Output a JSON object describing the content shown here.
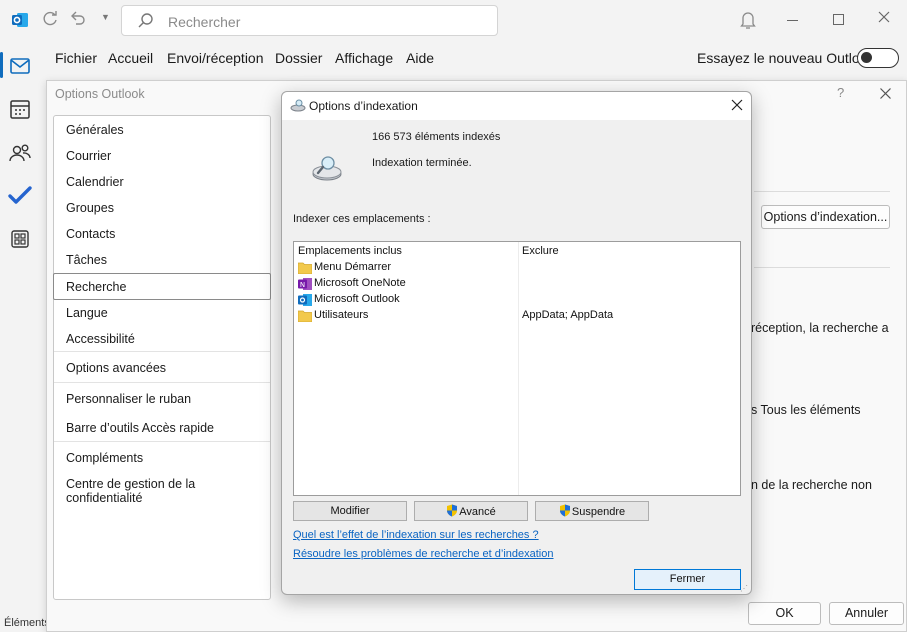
{
  "titlebar": {
    "search_placeholder": "Rechercher"
  },
  "menu": {
    "items": [
      "Fichier",
      "Accueil",
      "Envoi/réception",
      "Dossier",
      "Affichage",
      "Aide"
    ],
    "try_new": "Essayez le nouveau Outlook"
  },
  "options_dialog": {
    "title": "Options Outlook",
    "categories": [
      "Générales",
      "Courrier",
      "Calendrier",
      "Groupes",
      "Contacts",
      "Tâches",
      "Recherche",
      "Langue",
      "Accessibilité",
      "Options avancées",
      "Personnaliser le ruban",
      "Barre d’outils Accès rapide",
      "Compléments",
      "Centre de gestion de la confidentialité"
    ],
    "selected": "Recherche",
    "indexing_button": "Options d’indexation...",
    "partial_texts": [
      "réception, la recherche a",
      "s Tous les éléments",
      "n de la recherche non"
    ],
    "ok": "OK",
    "cancel": "Annuler"
  },
  "indexing_dialog": {
    "title": "Options d’indexation",
    "count": "166 573 éléments indexés",
    "status": "Indexation terminée.",
    "locations_label": "Indexer ces emplacements :",
    "col_included": "Emplacements inclus",
    "col_exclude": "Exclure",
    "rows": [
      {
        "name": "Menu Démarrer",
        "icon": "folder-icon",
        "exclude": ""
      },
      {
        "name": "Microsoft OneNote",
        "icon": "onenote-icon",
        "exclude": ""
      },
      {
        "name": "Microsoft Outlook",
        "icon": "outlook-icon",
        "exclude": ""
      },
      {
        "name": "Utilisateurs",
        "icon": "folder-icon",
        "exclude": "AppData; AppData"
      }
    ],
    "btn_modify": "Modifier",
    "btn_advanced": "Avancé",
    "btn_pause": "Suspendre",
    "link_effect": "Quel est l’effet de l’indexation sur les recherches ?",
    "link_troubleshoot": "Résoudre les problèmes de recherche et d’indexation",
    "btn_close": "Fermer"
  },
  "statusbar": {
    "text": "Éléments"
  },
  "colors": {
    "accent": "#0f6cbd",
    "onenote": "#7719aa",
    "outlook": "#0f6cbd",
    "folder": "#f2c94c"
  }
}
